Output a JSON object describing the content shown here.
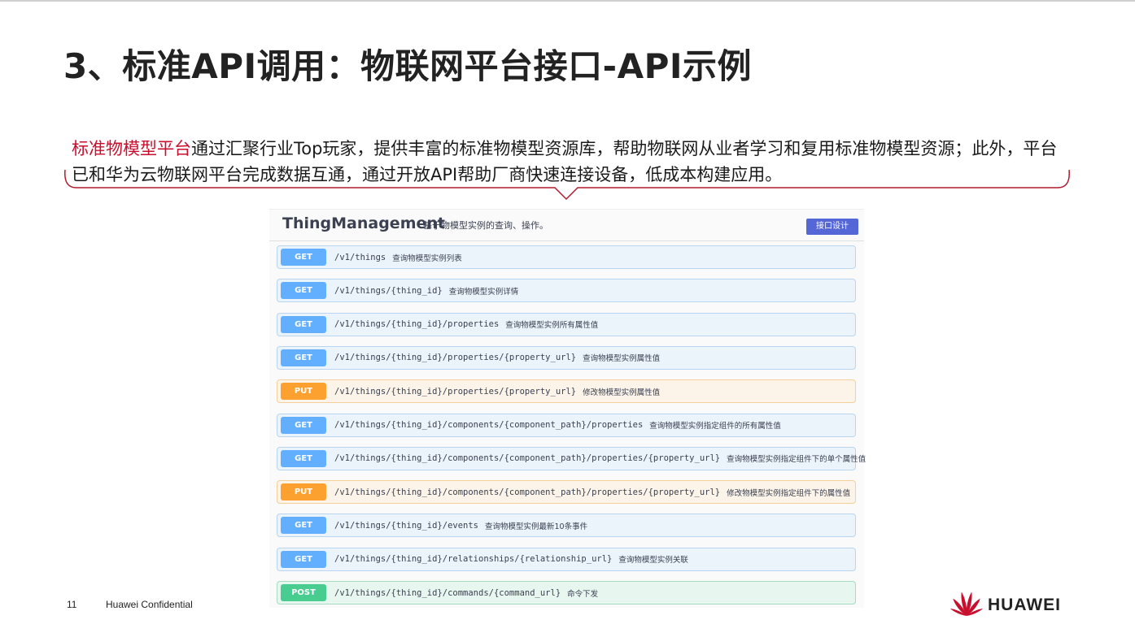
{
  "slide": {
    "title": "3、标准API调用：物联网平台接口-API示例",
    "intro_highlight": "标准物模型平台",
    "intro_rest": "通过汇聚行业Top玩家，提供丰富的标准物模型资源库，帮助物联网从业者学习和复用标准物模型资源；此外，平台已和华为云物联网平台完成数据互通，通过开放API帮助厂商快速连接设备，低成本构建应用。",
    "highlight_color": "#c8102e"
  },
  "panel": {
    "title": "ThingManagement",
    "description": "基于物模型实例的查询、操作。",
    "button_label": "接口设计",
    "operations": [
      {
        "method": "GET",
        "path": "/v1/things",
        "desc": "查询物模型实例列表"
      },
      {
        "method": "GET",
        "path": "/v1/things/{thing_id}",
        "desc": "查询物模型实例详情"
      },
      {
        "method": "GET",
        "path": "/v1/things/{thing_id}/properties",
        "desc": "查询物模型实例所有属性值"
      },
      {
        "method": "GET",
        "path": "/v1/things/{thing_id}/properties/{property_url}",
        "desc": "查询物模型实例属性值"
      },
      {
        "method": "PUT",
        "path": "/v1/things/{thing_id}/properties/{property_url}",
        "desc": "修改物模型实例属性值"
      },
      {
        "method": "GET",
        "path": "/v1/things/{thing_id}/components/{component_path}/properties",
        "desc": "查询物模型实例指定组件的所有属性值"
      },
      {
        "method": "GET",
        "path": "/v1/things/{thing_id}/components/{component_path}/properties/{property_url}",
        "desc": "查询物模型实例指定组件下的单个属性值"
      },
      {
        "method": "PUT",
        "path": "/v1/things/{thing_id}/components/{component_path}/properties/{property_url}",
        "desc": "修改物模型实例指定组件下的属性值"
      },
      {
        "method": "GET",
        "path": "/v1/things/{thing_id}/events",
        "desc": "查询物模型实例最新10条事件"
      },
      {
        "method": "GET",
        "path": "/v1/things/{thing_id}/relationships/{relationship_url}",
        "desc": "查询物模型实例关联"
      },
      {
        "method": "POST",
        "path": "/v1/things/{thing_id}/commands/{command_url}",
        "desc": "命令下发"
      }
    ],
    "method_colors": {
      "GET": "#61affe",
      "PUT": "#fca130",
      "POST": "#49cc90"
    }
  },
  "footer": {
    "page_number": "11",
    "confidential": "Huawei Confidential",
    "brand": "HUAWEI",
    "logo_icon": "huawei-petal-logo-icon"
  }
}
